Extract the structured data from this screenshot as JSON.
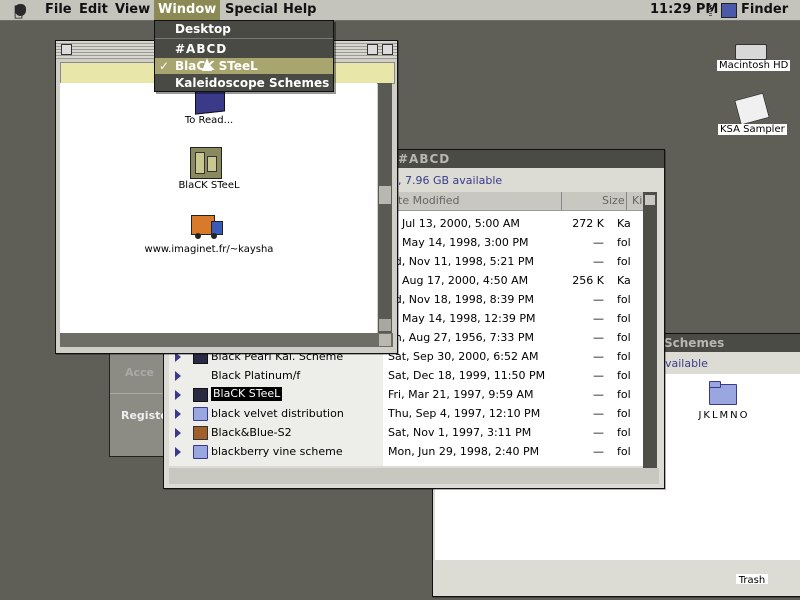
{
  "menubar": {
    "items": [
      "File",
      "Edit",
      "View",
      "Window",
      "Special",
      "Help"
    ],
    "clock": "11:29 PM",
    "app": "Finder"
  },
  "window_menu": {
    "items": [
      {
        "label": "Desktop",
        "checked": false
      },
      {
        "label": "#ABCD",
        "checked": false
      },
      {
        "label": "BlaCK STeeL",
        "checked": true
      },
      {
        "label": "Kaleidoscope Schemes",
        "checked": false
      }
    ]
  },
  "front_window": {
    "icons": [
      {
        "label": "To Read...",
        "icon": "document-icon"
      },
      {
        "label": "BlaCK STeeL",
        "icon": "control-panel-icon"
      },
      {
        "label": "www.imaginet.fr/~kaysha",
        "icon": "delivery-truck-icon"
      }
    ]
  },
  "abcd_window": {
    "title": "#ABCD",
    "info": ", 7.96 GB available",
    "columns": {
      "date": "te Modified",
      "size": "Size",
      "kind": "Ki"
    },
    "rows": [
      {
        "name": "",
        "date": "u, Jul 13, 2000, 5:00 AM",
        "size": "272 K",
        "kind": "Ka",
        "icon": ""
      },
      {
        "name": "",
        "date": "u, May 14, 1998, 3:00 PM",
        "size": "—",
        "kind": "fol",
        "icon": ""
      },
      {
        "name": "",
        "date": "ed, Nov 11, 1998, 5:21 PM",
        "size": "—",
        "kind": "fol",
        "icon": ""
      },
      {
        "name": "",
        "date": "u, Aug 17, 2000, 4:50 AM",
        "size": "256 K",
        "kind": "Ka",
        "icon": ""
      },
      {
        "name": "",
        "date": "ed, Nov 18, 1998, 8:39 PM",
        "size": "—",
        "kind": "fol",
        "icon": ""
      },
      {
        "name": "",
        "date": "u, May 14, 1998, 12:39 PM",
        "size": "—",
        "kind": "fol",
        "icon": ""
      },
      {
        "name": "",
        "date": "on, Aug 27, 1956, 7:33 PM",
        "size": "—",
        "kind": "fol",
        "icon": ""
      },
      {
        "name": "Black Pearl Kal. Scheme",
        "date": "Sat, Sep 30, 2000, 6:52 AM",
        "size": "—",
        "kind": "fol",
        "icon": "scheme"
      },
      {
        "name": "Black Platinum/f",
        "date": "Sat, Dec 18, 1999, 11:50 PM",
        "size": "—",
        "kind": "fol",
        "icon": "none"
      },
      {
        "name": "BlaCK STeeL",
        "date": "Fri, Mar 21, 1997, 9:59 AM",
        "size": "—",
        "kind": "fol",
        "icon": "scheme"
      },
      {
        "name": "black velvet distribution",
        "date": "Thu, Sep 4, 1997, 12:10 PM",
        "size": "—",
        "kind": "fol",
        "icon": "folder"
      },
      {
        "name": "Black&Blue-S2",
        "date": "Sat, Nov 1, 1997, 3:11 PM",
        "size": "—",
        "kind": "fol",
        "icon": "arrow"
      },
      {
        "name": "blackberry vine scheme",
        "date": "Mon, Jun 29, 1998, 2:40 PM",
        "size": "—",
        "kind": "fol",
        "icon": "folder"
      }
    ]
  },
  "kaleido_window": {
    "title": "Schemes",
    "info": "vailable",
    "folder_label": "JKLMNO"
  },
  "bg_window": {
    "text1": "Acce",
    "text2": "Registe"
  },
  "desktop": {
    "items": [
      {
        "label": "Macintosh HD",
        "icon": "hard-disk-icon"
      },
      {
        "label": "KSA Sampler",
        "icon": "application-icon"
      },
      {
        "label": "Trash",
        "icon": "trash-icon"
      }
    ]
  },
  "colors": {
    "desktop": "#5f5f57",
    "menu_highlight": "#8b8a55",
    "accent": "#3a3a88"
  }
}
